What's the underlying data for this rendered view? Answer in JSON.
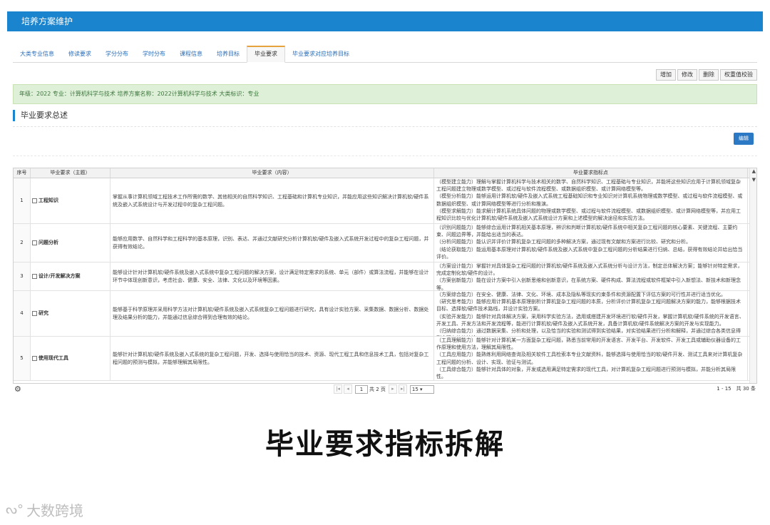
{
  "window": {
    "title": "培养方案维护"
  },
  "tabs": [
    {
      "label": "大类专业信息",
      "active": false
    },
    {
      "label": "修读要求",
      "active": false
    },
    {
      "label": "学分分布",
      "active": false
    },
    {
      "label": "学时分布",
      "active": false
    },
    {
      "label": "课程信息",
      "active": false
    },
    {
      "label": "培养目标",
      "active": false
    },
    {
      "label": "毕业要求",
      "active": true
    },
    {
      "label": "毕业要求对应培养目标",
      "active": false
    }
  ],
  "toolbar": {
    "add": "增加",
    "modify": "修改",
    "delete": "删除",
    "weight_check": "权重值校验"
  },
  "info": {
    "text": "年级：2022 专业：计算机科学与技术 培养方案名称：2022计算机科学与技术 大类标识：专业"
  },
  "section": {
    "title": "毕业要求总述",
    "edit_label": "编辑"
  },
  "grid": {
    "headers": [
      "序号",
      "毕业要求（主题）",
      "毕业要求（内容）",
      "毕业要求指标点"
    ],
    "rows": [
      {
        "index": "1",
        "theme": "工程知识",
        "content": "掌握从事计算机领域工程技术工作所需的数学、其他相关的自然科学知识、工程基础和计算机专业知识，并能应用这些知识解决计算机软/硬件系统及嵌入式系统设计与开发过程中的复杂工程问题。",
        "indicators": [
          "（模型建立能力）理解与掌握计算机科学与技术相关的数学、自然科学知识、工程基础与专业知识，并能将这些知识应用于计算机领域复杂工程问题建立物理或数学模型、或过程与软件流程模型、或数据组织模型、或计算网络模型等。",
          "（模型分析能力）能够运用计算机软/硬件及嵌入式系统工程基础知识和专业知识对计算机系统物理或数学模型、或过程与软件流程模型、或数据组织模型、或计算网络模型等进行分析和推演。",
          "（模型求解能力）能求解计算机系统具体问题的物理或数学模型、或过程与软件流程模型、或数据组织模型、或计算网络模型等，并应用工程知识比较与优化计算机软/硬件系统及嵌入式系统设计方案和上述模型的解决途径和实现方法。"
        ]
      },
      {
        "index": "2",
        "theme": "问题分析",
        "content": "能够应用数学、自然科学和工程科学的基本原理，识别、表达、并通过文献研究分析计算机软/硬件及嵌入式系统开发过程中的复杂工程问题，并获得有效结论。",
        "indicators": [
          "（识别问题能力）能够综合运用计算机相关基本原理，辨识和判断计算机软/硬件系统中相关复杂工程问题的核心要素、关键流程、主要约束、问题边界等，并能给出适当的表达。",
          "（分析问题能力）能认识并评价计算机复杂工程问题的多种解决方案，通过现有文献和方案进行比较、研究和分析。",
          "（结论获取能力）能运用基本原理对计算机软/硬件系统及嵌入式系统中复杂工程问题的分析结果进行归纳、总结，获得有效结论并给出恰当评价。"
        ]
      },
      {
        "index": "3",
        "theme": "设计/开发解决方案",
        "content": "能够设计针对计算机软/硬件系统及嵌入式系统中复杂工程问题的解决方案，设计满足特定需求的系统、单元（部件）或算法流程，并能够在设计环节中体现创新意识，考虑社会、健康、安全、法律、文化以及环境等因素。",
        "indicators": [
          "（方案设计能力）掌握针对具体复杂工程问题的计算机软/硬件系统及嵌入式系统分析与设计方法，制定总体解决方案；能够针对特定需求，完成定制化软/硬件的设计。",
          "（方案创新能力）能在设计方案中引入创新思维和创新意识，在系统方案、硬件构成、算法流程或软件框架中引入新想法、新技术和新理念等。"
        ]
      },
      {
        "index": "4",
        "theme": "研究",
        "content": "能够基于科学原理并采用科学方法对计算机软/硬件系统及嵌入式系统复杂工程问题进行研究，具有设计实验方案、采集数据、数据分析、数据处理及结果分析的能力，并能通过信息综合得到合理有效的结论。",
        "indicators": [
          "（方案综合能力）在安全、健康、法律、文化、环境、成本及隐私等现实约束条件和资源配置下评估方案的可行性并进行适当优化。",
          "（研究思考能力）能够应用计算机基本原理剖析计算机复杂工程问题的本质，分析评价计算机复杂工程问题解决方案的能力，能够根据技术目标、选择软/硬件技术路线，并设计实验方案。",
          "（实验开发能力）能够针对具体解决方案，采用科学实验方法，选用或搭建开发环境进行软/硬件开发，掌握计算机软/硬件系统的开发语言、开发工具、开发方法和开发流程等，能进行计算机软/硬件及嵌入式系统开发，具备计算机软/硬件系统解决方案的开发与实现能力。",
          "（归纳综合能力）通过数据采集、分析和处理，以及恰当的实验和测试得到实验结果，对实验结果进行分析和解释，并通过综合各类信息得到合理有效的结论。"
        ]
      },
      {
        "index": "5",
        "theme": "使用现代工具",
        "content": "能够针对计算机软/硬件系统及嵌入式系统的复杂工程问题，开发、选择与使用恰当的技术、资源、现代工程工具和信息技术工具，包括对复杂工程问题的预测与模拟，并能够理解其局限性。",
        "indicators": [
          "（工具理解能力）能够针对计算机某一方面复杂工程问题，熟悉当前常用的开发语言、开发平台、开发软件、开发工具或辅助仪器设备的工作原理和使用方法，理解其局限性。",
          "（工具应用能力）能熟练利用网络查询及相关软件工具检索本专业文献资料，能够选择与使用恰当的软/硬件开发、测试工具来对计算机复杂工程问题的分析、设计、实现、验证与测试。",
          "（工具综合能力）能够针对具体的对象，开发或选用满足特定需求的现代工具，对计算机复杂工程问题进行预测与模拟，并能分析其局限性。"
        ]
      }
    ]
  },
  "pager": {
    "current_page": "1",
    "total_pages_text": "共 2 页",
    "page_size": "15",
    "range_text": "1 - 15　共 30 条"
  },
  "caption": "毕业要求指标拆解",
  "watermark": {
    "text": "大数跨境"
  }
}
